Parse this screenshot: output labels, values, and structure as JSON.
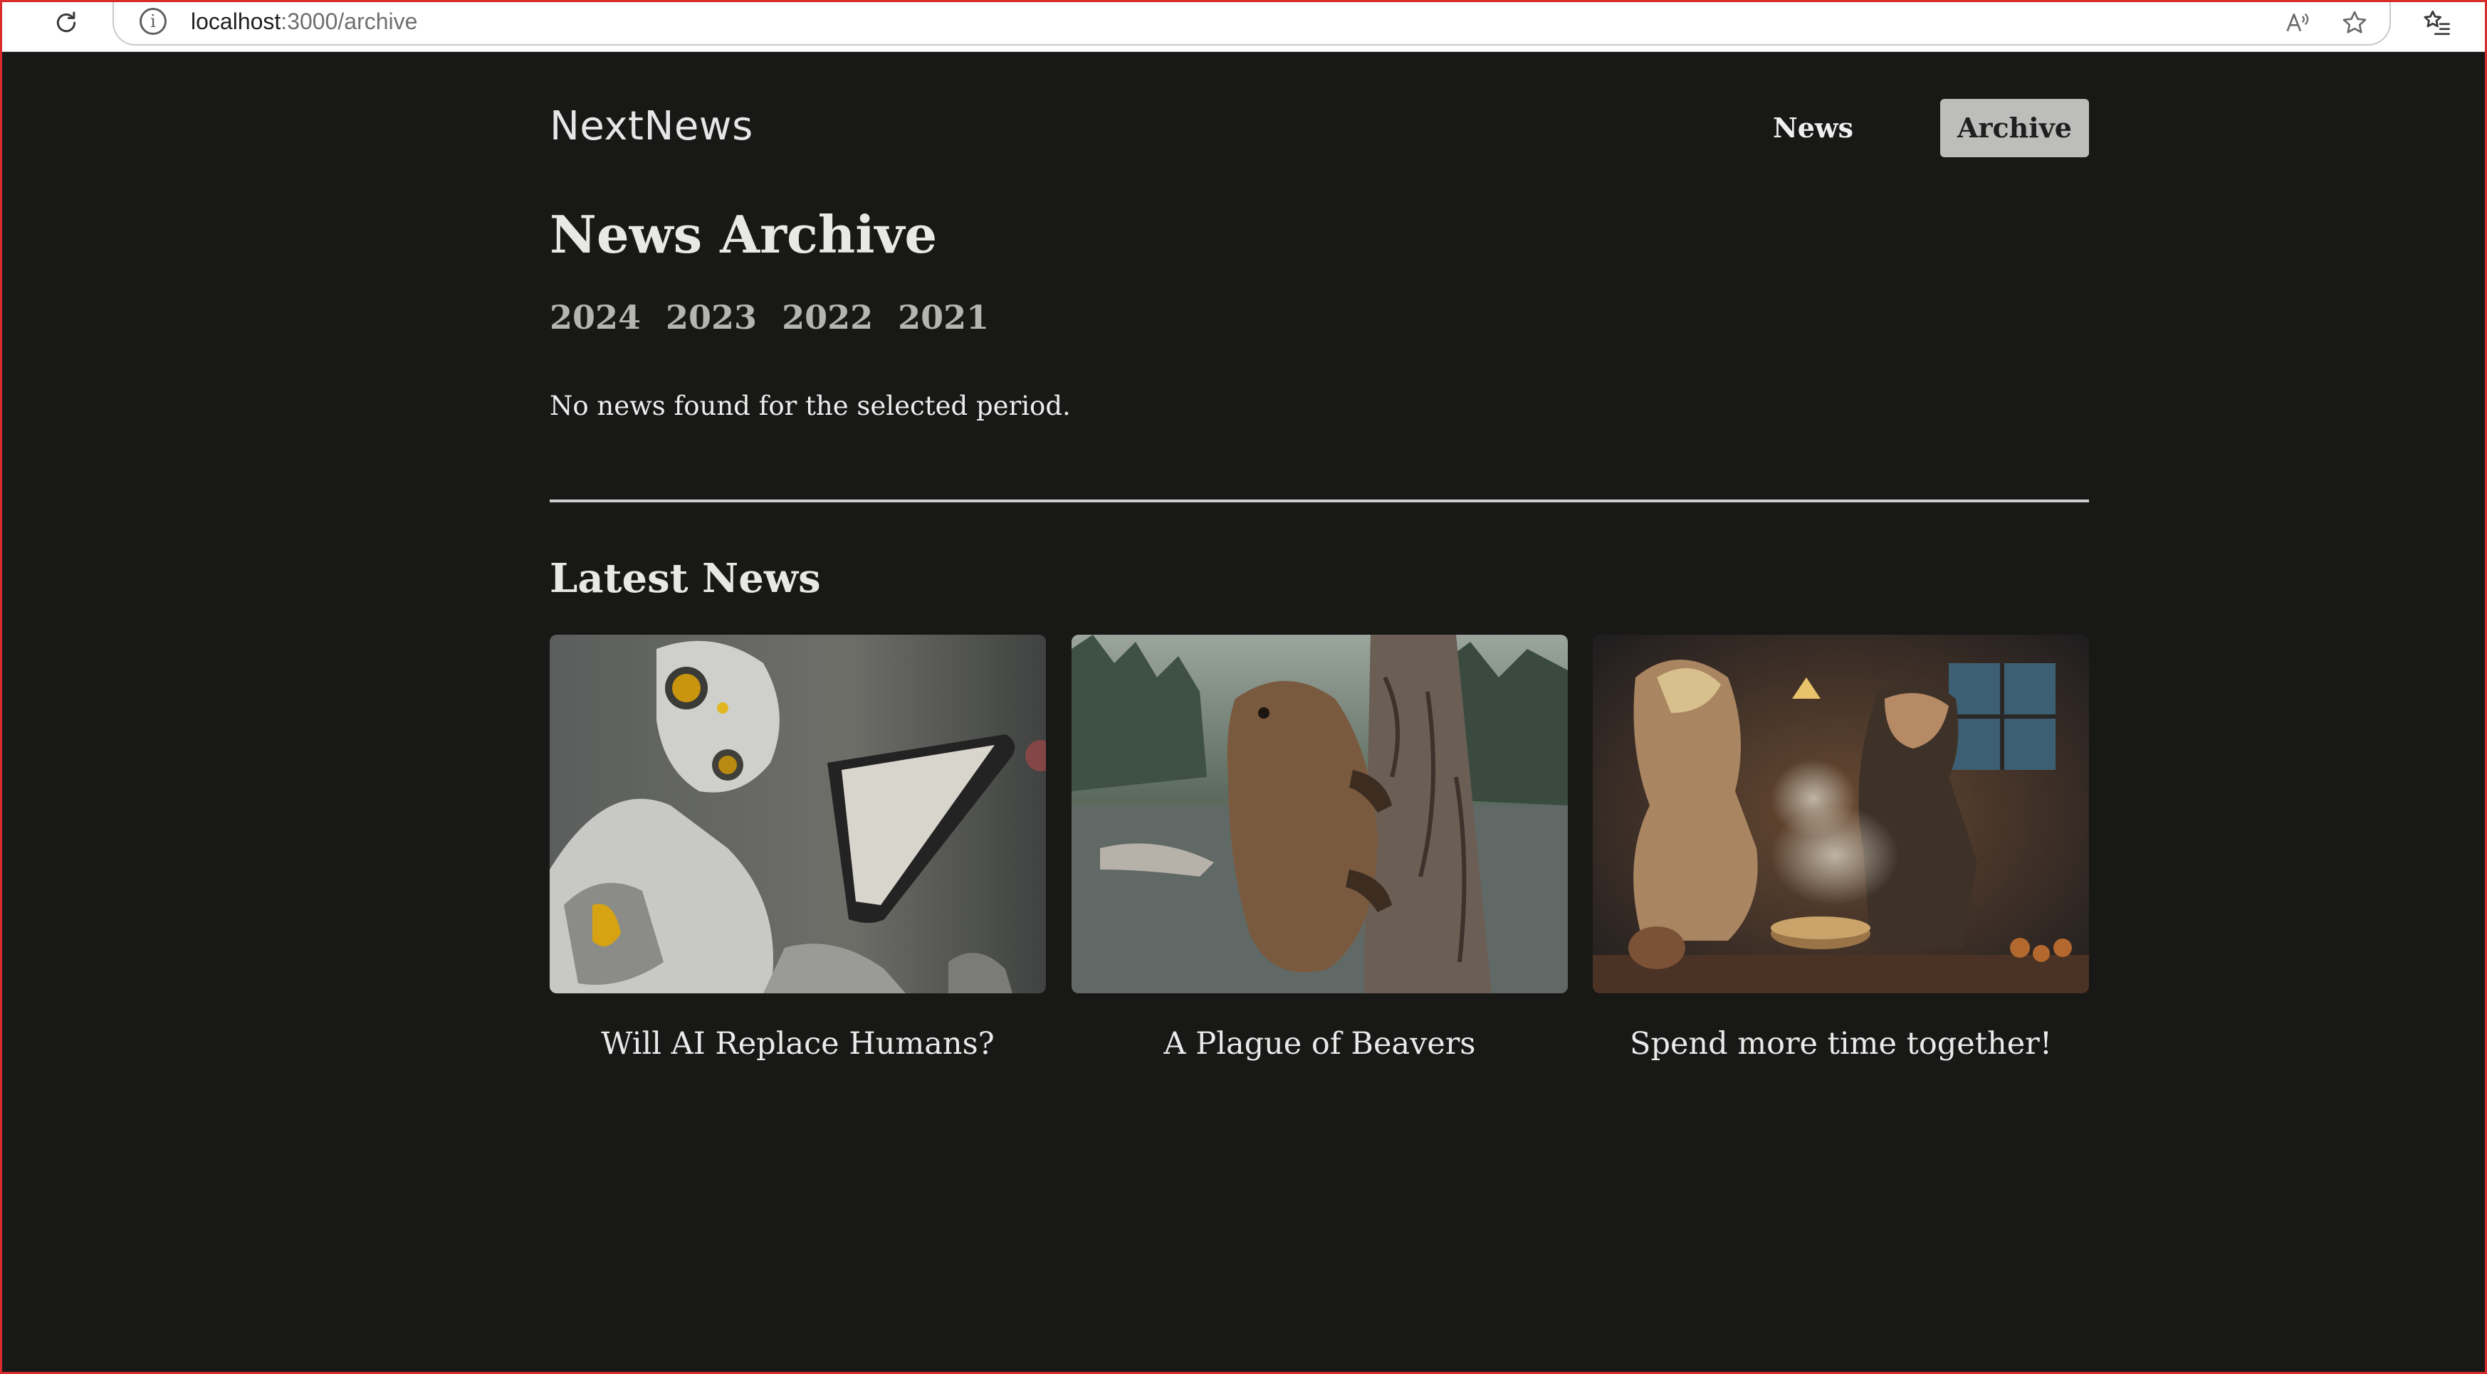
{
  "browser": {
    "url_host": "localhost",
    "url_path": ":3000/archive"
  },
  "header": {
    "logo": "NextNews",
    "nav": {
      "news_label": "News",
      "archive_label": "Archive"
    }
  },
  "archive": {
    "title": "News Archive",
    "years": [
      "2024",
      "2023",
      "2022",
      "2021"
    ],
    "empty_message": "No news found for the selected period."
  },
  "latest": {
    "title": "Latest News",
    "items": [
      {
        "title": "Will AI Replace Humans?",
        "image": "robot-reading-tablet"
      },
      {
        "title": "A Plague of Beavers",
        "image": "beaver-climbing-tree"
      },
      {
        "title": "Spend more time together!",
        "image": "couple-cooking-in-kitchen"
      }
    ]
  },
  "colors": {
    "page_background": "#181817",
    "active_nav_background": "#bdbdbb",
    "frame_border": "#d92b2b"
  }
}
